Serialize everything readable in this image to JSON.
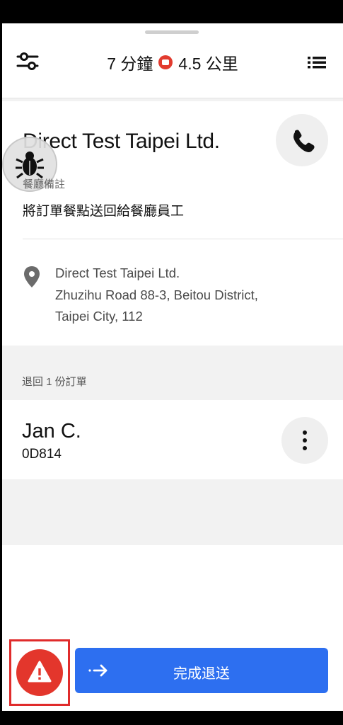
{
  "header": {
    "eta_minutes": "7 分鐘",
    "distance": "4.5 公里"
  },
  "restaurant": {
    "name": "Direct Test Taipei Ltd.",
    "note_label": "餐廳備註",
    "note_text": "將訂單餐點送回給餐廳員工",
    "address_lines": [
      "Direct Test Taipei Ltd.",
      "Zhuzihu Road 88-3, Beitou District,",
      "Taipei City, 112"
    ]
  },
  "orders": {
    "section_label": "退回 1 份訂單",
    "customer_name": "Jan C.",
    "order_code": "0D814"
  },
  "footer": {
    "primary_label": "完成退送"
  },
  "colors": {
    "primary": "#2d6ff0",
    "alert": "#e3362c",
    "highlight_outline": "#e02b2b"
  },
  "icons": [
    "filter-icon",
    "stop-icon",
    "list-icon",
    "phone-icon",
    "bug-icon",
    "location-pin-icon",
    "more-vertical-icon",
    "warning-icon",
    "arrow-right-icon"
  ]
}
